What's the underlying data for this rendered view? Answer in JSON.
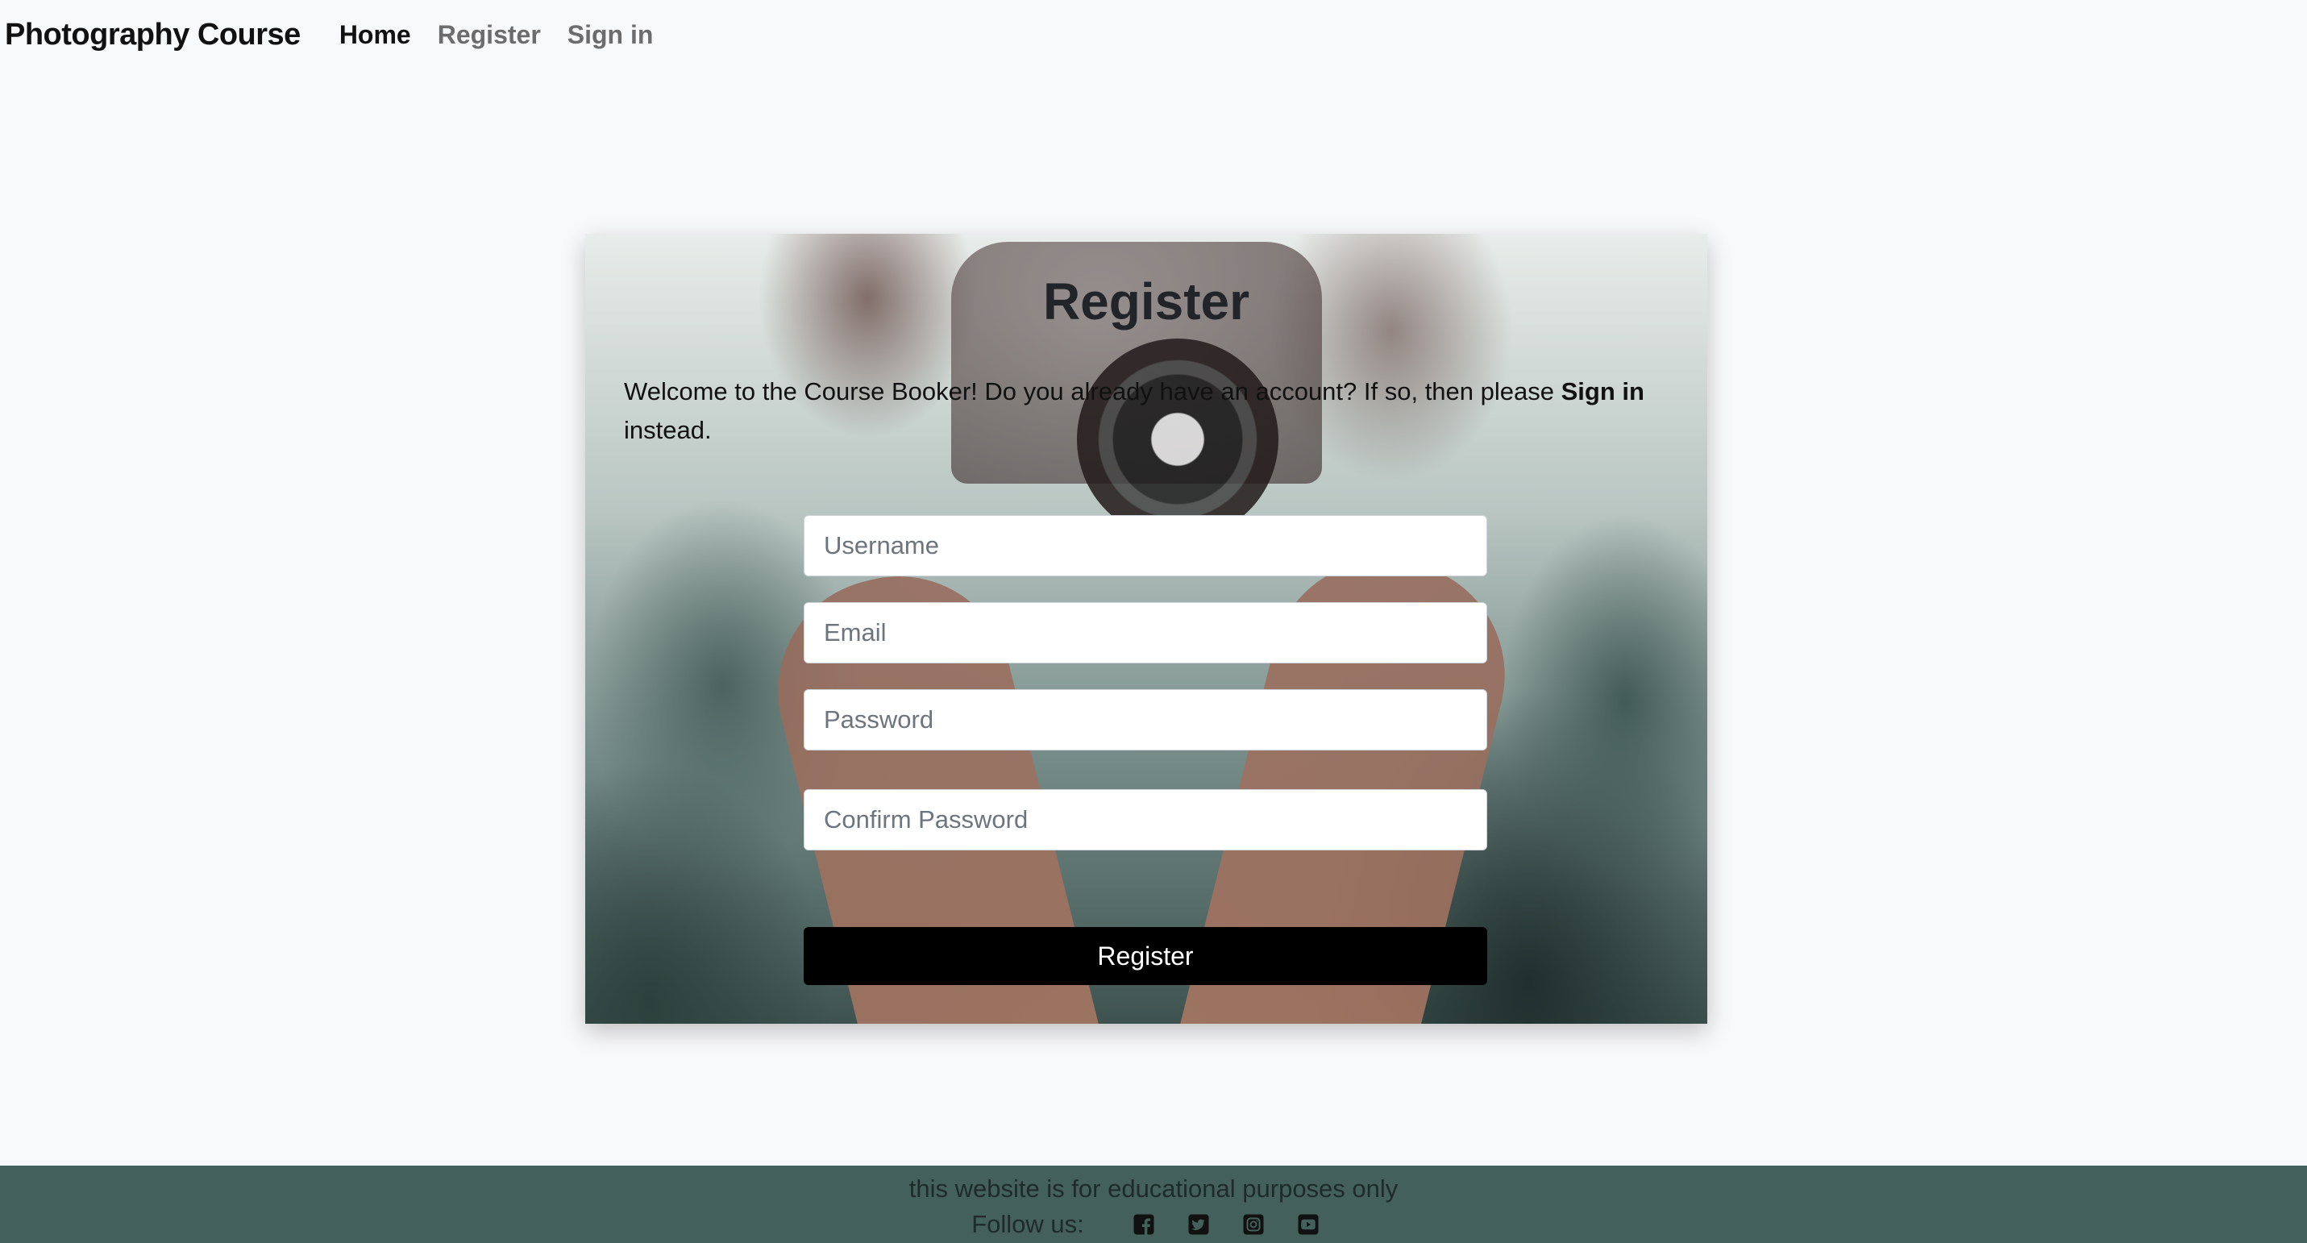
{
  "nav": {
    "brand": "Photography Course",
    "links": [
      {
        "label": "Home",
        "active": true
      },
      {
        "label": "Register",
        "active": false
      },
      {
        "label": "Sign in",
        "active": false
      }
    ]
  },
  "card": {
    "title": "Register",
    "intro_before": "Welcome to the Course Booker! Do you already have an account? If so, then please ",
    "intro_bold": "Sign in",
    "intro_after": " instead.",
    "fields": {
      "username_placeholder": "Username",
      "email_placeholder": "Email",
      "password_placeholder": "Password",
      "confirm_password_placeholder": "Confirm Password"
    },
    "submit_label": "Register"
  },
  "footer": {
    "note": "this website is for educational purposes only",
    "follow_label": "Follow us:",
    "social_icons": [
      "facebook-icon",
      "twitter-icon",
      "instagram-icon",
      "youtube-icon"
    ],
    "background": "#43615a"
  },
  "colors": {
    "page_background": "#f8f9fa",
    "button_background": "#000000"
  }
}
